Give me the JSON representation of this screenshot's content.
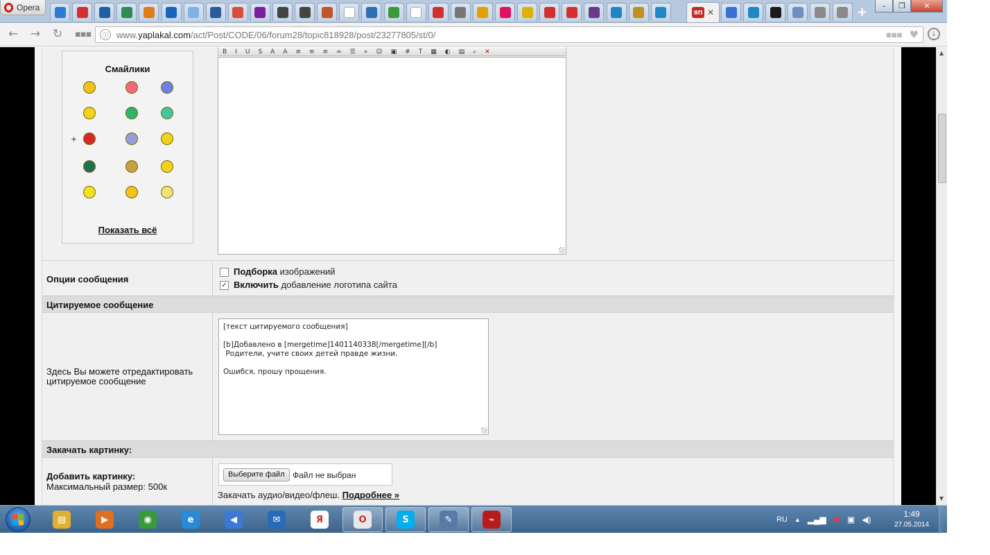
{
  "browser": {
    "menu_label": "Opera",
    "active_tab_label": "ЯП",
    "active_tab_close": "✕",
    "url_prefix": "www.",
    "url_host": "yaplakal.com",
    "url_path": "/act/Post/CODE/06/forum28/topic818928/post/23277805/st/0/",
    "tab_icons": [
      {
        "name": "pen-icon",
        "color": "#2a7bd6"
      },
      {
        "name": "bars-icon",
        "color": "#d32f2f"
      },
      {
        "name": "diamond-icon",
        "color": "#1f5fa8"
      },
      {
        "name": "chart-icon",
        "color": "#2e8b57"
      },
      {
        "name": "puzzle-icon",
        "color": "#e07b1a"
      },
      {
        "name": "m-icon",
        "color": "#1565c0"
      },
      {
        "name": "snowflake-icon",
        "color": "#7fb2e6"
      },
      {
        "name": "gear-icon",
        "color": "#2b5b9a"
      },
      {
        "name": "gplus-icon",
        "color": "#dd4b39"
      },
      {
        "name": "scorpio-icon",
        "color": "#7b1fa2"
      },
      {
        "name": "cross-icon",
        "color": "#444444"
      },
      {
        "name": "cross-icon",
        "color": "#444444"
      },
      {
        "name": "mushroom-icon",
        "color": "#c0572b"
      },
      {
        "name": "blank-page-icon",
        "color": "#ffffff"
      },
      {
        "name": "eye-icon",
        "color": "#2a6fb0"
      },
      {
        "name": "dots-icon",
        "color": "#3b9b3b"
      },
      {
        "name": "blank-page-icon",
        "color": "#ffffff"
      },
      {
        "name": "slash-icon",
        "color": "#d32f2f"
      },
      {
        "name": "mercedes-icon",
        "color": "#777777"
      },
      {
        "name": "at-icon",
        "color": "#e0a000"
      },
      {
        "name": "shape-icon",
        "color": "#e0115f"
      },
      {
        "name": "oval-icon",
        "color": "#e0b000"
      },
      {
        "name": "bars-icon",
        "color": "#d32f2f"
      },
      {
        "name": "bars-icon",
        "color": "#d32f2f"
      },
      {
        "name": "square-icon",
        "color": "#6a3a8a"
      },
      {
        "name": "arch-icon",
        "color": "#1e88c6"
      },
      {
        "name": "crest-icon",
        "color": "#c09020"
      },
      {
        "name": "arch-icon",
        "color": "#1e88c6"
      }
    ],
    "tab_icons_right": [
      {
        "name": "swirl-icon",
        "color": "#3a6fd6"
      },
      {
        "name": "arch-icon",
        "color": "#1e88c6"
      },
      {
        "name": "x-square-icon",
        "color": "#1b1b1b"
      },
      {
        "name": "pages-icon",
        "color": "#6f8fbf"
      },
      {
        "name": "page-icon",
        "color": "#8a8a8a"
      },
      {
        "name": "page-icon",
        "color": "#8a8a8a"
      }
    ],
    "new_tab_glyph": "+",
    "window_controls": [
      "–",
      "❐",
      "✕"
    ]
  },
  "smilies": {
    "title": "Смайлики",
    "show_all": "Показать всё",
    "items": [
      {
        "name": "cool-smiley-icon",
        "color": "#f2c21b"
      },
      {
        "name": "love-smiley-icon",
        "color": "#f06a7a"
      },
      {
        "name": "sad-blue-smiley-icon",
        "color": "#6f7fe6"
      },
      {
        "name": "thinking-smiley-icon",
        "color": "#f2d21b"
      },
      {
        "name": "gun-smiley-icon",
        "color": "#2fb36f"
      },
      {
        "name": "green-smiley-icon",
        "color": "#3fc7a0"
      },
      {
        "name": "boxing-smiley-icon",
        "color": "#d62828"
      },
      {
        "name": "cheer-smiley-icon",
        "color": "#9b9bd6"
      },
      {
        "name": "scared-smiley-icon",
        "color": "#f2d21b"
      },
      {
        "name": "dark-smiley-icon",
        "color": "#1f6f55"
      },
      {
        "name": "clap-smiley-icon",
        "color": "#c8a040"
      },
      {
        "name": "girl-smiley-icon",
        "color": "#f2d21b"
      },
      {
        "name": "pencil-smiley-icon",
        "color": "#f2e21b"
      },
      {
        "name": "laugh-smiley-icon",
        "color": "#f2c21b"
      },
      {
        "name": "star-smiley-icon",
        "color": "#f2e27b"
      }
    ],
    "extra_glyph": "+"
  },
  "editor": {
    "toolbar": [
      "B",
      "I",
      "U",
      "S",
      "A",
      "A",
      "≡",
      "≡",
      "≡",
      "∞",
      "☰",
      "»",
      "☺",
      "▣",
      "#",
      "T",
      "▦",
      "◐",
      "▤",
      "⌕",
      "✕"
    ]
  },
  "options": {
    "label": "Опции сообщения",
    "opt1_bold": "Подборка",
    "opt1_rest": " изображений",
    "opt1_checked": false,
    "opt2_bold": "Включить",
    "opt2_rest": " добавление логотипа сайта",
    "opt2_checked": true
  },
  "quote": {
    "section": "Цитируемое сообщение",
    "hint": "Здесь Вы можете отредактировать цитируемое сообщение",
    "text": "[текст цитируемого сообщения]\n\n[b]Добавлено в [mergetime]1401140338[/mergetime][/b]\n Родители, учите своих детей правде жизни.\n\nОшибся, прошу прощения."
  },
  "upload": {
    "section": "Закачать картинку:",
    "add_label": "Добавить картинку:",
    "max_size": "Максимальный размер: 500к",
    "choose_button": "Выберите файл",
    "no_file": "Файл не выбран",
    "av_text": "Закачать аудио/видео/флеш. ",
    "more_link": "Подробнее »"
  },
  "taskbar": {
    "apps": [
      {
        "name": "explorer-icon",
        "color": "#e0b030",
        "glyph": "▤",
        "open": false
      },
      {
        "name": "media-player-icon",
        "color": "#e07020",
        "glyph": "▶",
        "open": false
      },
      {
        "name": "chrome-icon",
        "color": "#3a9a3a",
        "glyph": "◉",
        "open": false
      },
      {
        "name": "ie-icon",
        "color": "#2a8ad6",
        "glyph": "e",
        "open": false
      },
      {
        "name": "speaker-app-icon",
        "color": "#3a7ad6",
        "glyph": "◀",
        "open": false
      },
      {
        "name": "mail-icon",
        "color": "#2a6ab6",
        "glyph": "✉",
        "open": false
      },
      {
        "name": "yandex-icon",
        "color": "#ffffff",
        "glyph": "Я",
        "open": false
      },
      {
        "name": "opera-icon",
        "color": "#e8e8e8",
        "glyph": "O",
        "open": true
      },
      {
        "name": "skype-icon",
        "color": "#00aff0",
        "glyph": "S",
        "open": true
      },
      {
        "name": "notes-icon",
        "color": "#5a7aa6",
        "glyph": "✎",
        "open": true
      },
      {
        "name": "pdf-icon",
        "color": "#b71c1c",
        "glyph": "⌁",
        "open": true
      }
    ],
    "lang": "RU",
    "time": "1:49",
    "date": "27.05.2014"
  }
}
